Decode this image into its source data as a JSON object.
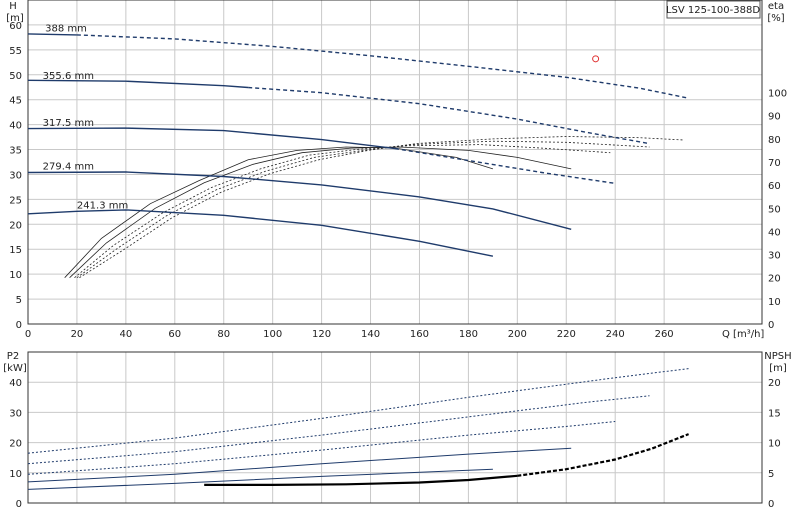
{
  "model_label": "LSV 125-100-388D",
  "colors": {
    "curve": "#1f3b6b",
    "eff": "#222222",
    "npsh": "#000000",
    "grid": "#c9c9c9",
    "duty_point": "#e03030"
  },
  "chart_data": [
    {
      "type": "line",
      "name": "head-efficiency",
      "xlabel": "Q [m³/h]",
      "ylabel_left_title": "H",
      "ylabel_left_unit": "[m]",
      "ylabel_right_title": "eta",
      "ylabel_right_unit": "[%]",
      "xlim": [
        0,
        300
      ],
      "ylim_left": [
        0,
        65
      ],
      "ylim_right": [
        0,
        140
      ],
      "grid": true,
      "x_ticks": [
        0,
        20,
        40,
        60,
        80,
        100,
        120,
        140,
        160,
        180,
        200,
        220,
        240,
        260
      ],
      "y_left_ticks": [
        0,
        5,
        10,
        15,
        20,
        25,
        30,
        35,
        40,
        45,
        50,
        55,
        60
      ],
      "y_right_ticks": [
        0,
        10,
        20,
        30,
        40,
        50,
        60,
        70,
        80,
        90,
        100
      ],
      "head_series": [
        {
          "name": "388 mm",
          "label_at": [
            7,
            58.7
          ],
          "solid_to": 20,
          "x": [
            0,
            20,
            60,
            100,
            140,
            180,
            220,
            250,
            270
          ],
          "y": [
            58.2,
            58.0,
            57.2,
            55.7,
            53.8,
            51.7,
            49.5,
            47.3,
            45.3
          ]
        },
        {
          "name": "355.6 mm",
          "label_at": [
            6,
            49.2
          ],
          "solid_to": 90,
          "x": [
            0,
            40,
            80,
            120,
            160,
            200,
            230,
            254
          ],
          "y": [
            48.9,
            48.7,
            47.8,
            46.4,
            44.2,
            41.1,
            38.3,
            36.2
          ]
        },
        {
          "name": "317.5 mm",
          "label_at": [
            6,
            39.7
          ],
          "solid_to": 150,
          "x": [
            0,
            40,
            80,
            120,
            150,
            180,
            210,
            240
          ],
          "y": [
            39.2,
            39.3,
            38.8,
            37.0,
            35.2,
            32.8,
            30.4,
            28.2
          ]
        },
        {
          "name": "279.4 mm",
          "label_at": [
            6,
            31.0
          ],
          "solid_to": 222,
          "x": [
            0,
            40,
            80,
            120,
            160,
            190,
            222
          ],
          "y": [
            30.4,
            30.5,
            29.6,
            27.9,
            25.5,
            23.1,
            19.0
          ]
        },
        {
          "name": "241.3 mm",
          "label_at": [
            20,
            23.2
          ],
          "solid_to": 190,
          "x": [
            0,
            20,
            40,
            80,
            120,
            160,
            190
          ],
          "y": [
            22.1,
            22.6,
            22.9,
            21.8,
            19.8,
            16.6,
            13.6
          ]
        }
      ],
      "eff_series": [
        {
          "dashed": false,
          "x": [
            15,
            30,
            50,
            70,
            90,
            110,
            130,
            150,
            175,
            190
          ],
          "y": [
            20,
            37,
            52,
            62,
            71,
            75,
            76.5,
            76,
            72,
            67
          ]
        },
        {
          "dashed": false,
          "x": [
            17,
            32,
            52,
            72,
            92,
            112,
            132,
            152,
            180,
            200,
            222
          ],
          "y": [
            20,
            35,
            50,
            61,
            69,
            74,
            76,
            76.5,
            75,
            72,
            67
          ]
        },
        {
          "dashed": true,
          "x": [
            19,
            35,
            55,
            75,
            95,
            115,
            135,
            155,
            185,
            210,
            238
          ],
          "y": [
            20,
            34,
            48,
            59,
            67,
            73,
            75.5,
            77,
            77.5,
            76,
            74
          ]
        },
        {
          "dashed": true,
          "x": [
            20,
            37,
            57,
            77,
            97,
            117,
            137,
            157,
            190,
            220,
            254
          ],
          "y": [
            20,
            33,
            47,
            58,
            66,
            72,
            75,
            77.5,
            79,
            78.5,
            76.5
          ]
        },
        {
          "dashed": true,
          "x": [
            21,
            39,
            59,
            79,
            99,
            119,
            139,
            159,
            190,
            220,
            250,
            268
          ],
          "y": [
            20,
            32,
            46,
            57,
            65,
            71,
            75,
            78,
            80,
            81,
            80.5,
            79.5
          ]
        }
      ],
      "duty_point": {
        "x": 232,
        "y": 53.2
      }
    },
    {
      "type": "line",
      "name": "power-npsh",
      "ylabel_left_title": "P2",
      "ylabel_left_unit": "[kW]",
      "ylabel_right_title": "NPSH",
      "ylabel_right_unit": "[m]",
      "xlim": [
        0,
        300
      ],
      "ylim_left": [
        0,
        50
      ],
      "ylim_right": [
        0,
        25
      ],
      "grid": true,
      "y_left_ticks": [
        0,
        10,
        20,
        30,
        40
      ],
      "y_right_ticks": [
        0,
        5,
        10,
        15,
        20
      ],
      "power_series": [
        {
          "dashed": true,
          "x": [
            0,
            60,
            120,
            180,
            240,
            270
          ],
          "y": [
            16.5,
            21.5,
            28,
            35,
            41.5,
            44.5
          ]
        },
        {
          "dashed": true,
          "x": [
            0,
            60,
            120,
            180,
            230,
            254
          ],
          "y": [
            13,
            17,
            22.5,
            28.5,
            33.5,
            35.5
          ]
        },
        {
          "dashed": true,
          "x": [
            0,
            60,
            120,
            180,
            222,
            240
          ],
          "y": [
            9.5,
            13,
            17.5,
            22.5,
            25.5,
            27
          ]
        },
        {
          "dashed": false,
          "x": [
            0,
            60,
            120,
            180,
            222
          ],
          "y": [
            7,
            9.5,
            13,
            16.2,
            18.1
          ]
        },
        {
          "dashed": false,
          "x": [
            0,
            60,
            120,
            190
          ],
          "y": [
            4.5,
            6.5,
            8.8,
            11.2
          ]
        }
      ],
      "npsh": {
        "solid_to": 200,
        "x": [
          72,
          100,
          130,
          160,
          180,
          200,
          220,
          240,
          255,
          270
        ],
        "y": [
          3.0,
          3.0,
          3.1,
          3.4,
          3.8,
          4.5,
          5.6,
          7.2,
          9.0,
          11.4
        ]
      }
    }
  ]
}
